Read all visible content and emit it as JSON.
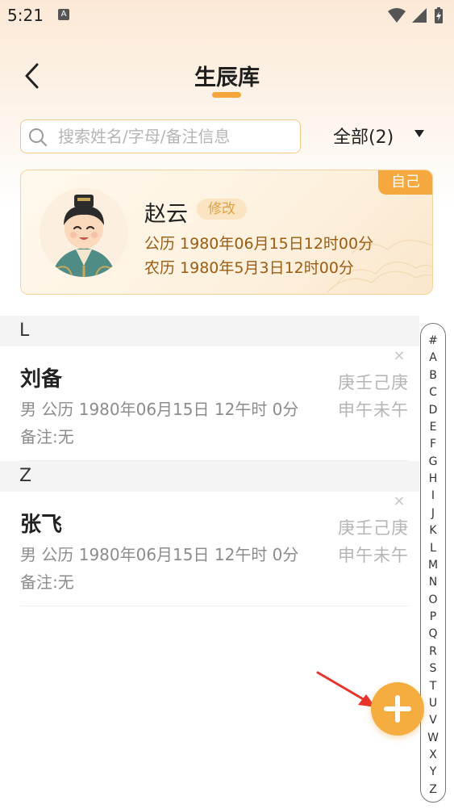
{
  "status_bar": {
    "time": "5:21",
    "notification_badge": "A",
    "icons": [
      "wifi-icon",
      "signal-icon",
      "battery-icon"
    ]
  },
  "header": {
    "title": "生辰库",
    "back_icon": "chevron-left-icon"
  },
  "search": {
    "placeholder": "搜索姓名/字母/备注信息",
    "value": ""
  },
  "filter": {
    "label": "全部(2)"
  },
  "self_card": {
    "tag": "自己",
    "name": "赵云",
    "edit_label": "修改",
    "solar": "公历 1980年06月15日12时00分",
    "lunar": "农历 1980年5月3日12时00分"
  },
  "groups": [
    {
      "letter": "L",
      "contacts": [
        {
          "name": "刘备",
          "info": "男 公历 1980年06月15日 12午时 0分",
          "note": "备注:无",
          "bazi_line1": "庚壬己庚",
          "bazi_line2": "申午未午",
          "delete_label": "×"
        }
      ]
    },
    {
      "letter": "Z",
      "contacts": [
        {
          "name": "张飞",
          "info": "男 公历 1980年06月15日 12午时 0分",
          "note": "备注:无",
          "bazi_line1": "庚壬己庚",
          "bazi_line2": "申午未午",
          "delete_label": "×"
        }
      ]
    }
  ],
  "index_bar": [
    "#",
    "A",
    "B",
    "C",
    "D",
    "E",
    "F",
    "G",
    "H",
    "I",
    "J",
    "K",
    "L",
    "M",
    "N",
    "O",
    "P",
    "Q",
    "R",
    "S",
    "T",
    "U",
    "V",
    "W",
    "X",
    "Y",
    "Z"
  ],
  "colors": {
    "accent": "#f6ad40",
    "card_text": "#9a5c12",
    "arrow": "#e8332a"
  }
}
